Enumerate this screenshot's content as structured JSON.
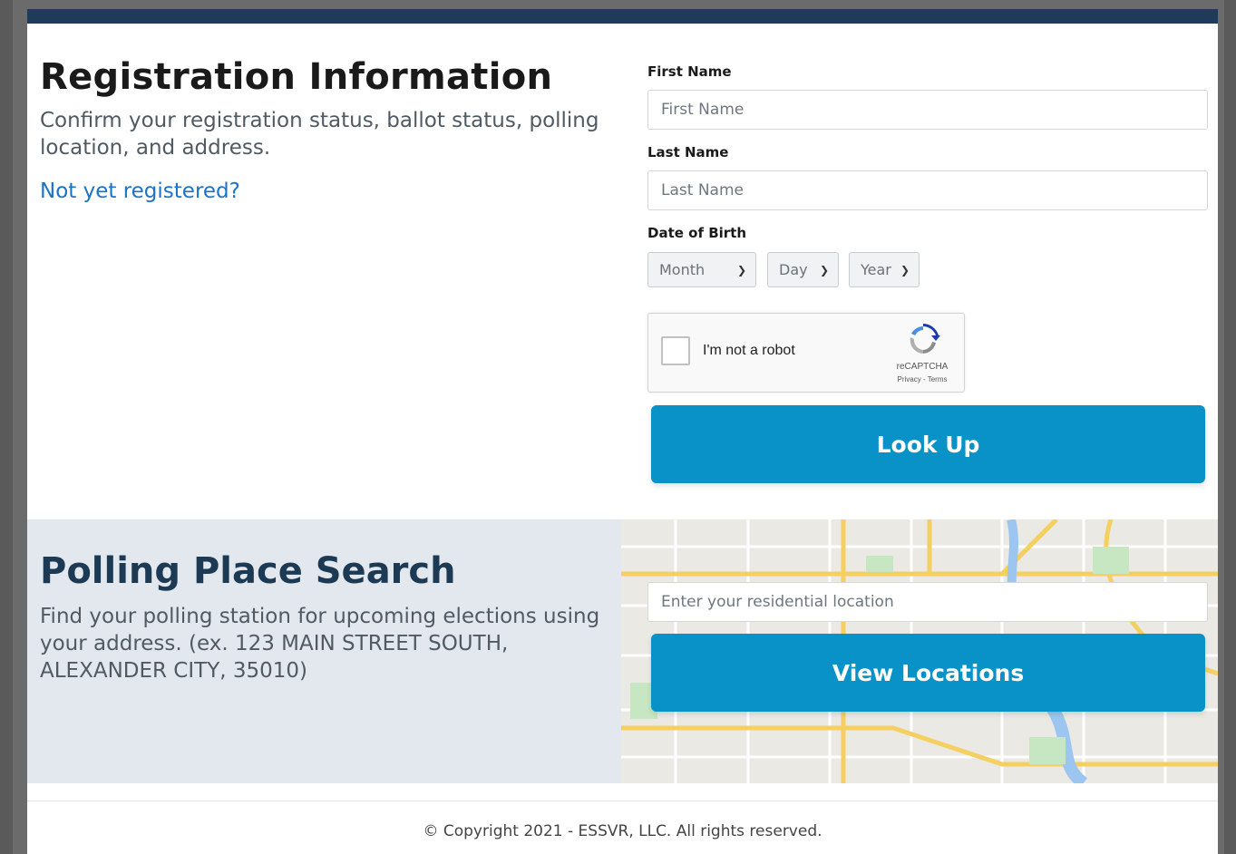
{
  "registration": {
    "title": "Registration Information",
    "subtitle": "Confirm your registration status, ballot status, polling location, and address.",
    "link": "Not yet registered?"
  },
  "form": {
    "first_name_label": "First Name",
    "first_name_placeholder": "First Name",
    "last_name_label": "Last Name",
    "last_name_placeholder": "Last Name",
    "dob_label": "Date of Birth",
    "month": "Month",
    "day": "Day",
    "year": "Year",
    "recaptcha_text": "I'm not a robot",
    "recaptcha_brand": "reCAPTCHA",
    "recaptcha_links": "Privacy - Terms",
    "lookup_button": "Look Up"
  },
  "polling": {
    "title": "Polling Place Search",
    "subtitle": "Find your polling station for upcoming elections using your address. (ex. 123 MAIN STREET SOUTH, ALEXANDER CITY, 35010)",
    "location_placeholder": "Enter your residential location",
    "view_button": "View Locations"
  },
  "footer": {
    "copyright": "© Copyright 2021 - ESSVR, LLC. All rights reserved."
  },
  "colors": {
    "header_bar": "#1f3a5a",
    "primary_button": "#0892c8",
    "link": "#1a73c8",
    "section_bg": "#e3e8ef"
  }
}
